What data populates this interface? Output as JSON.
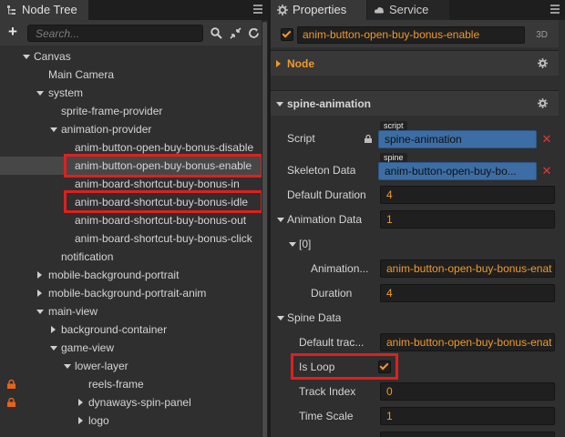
{
  "node_tree": {
    "tab_label": "Node Tree",
    "search_placeholder": "Search...",
    "rows": [
      {
        "label": "Canvas",
        "indent": 0,
        "arrow": "down"
      },
      {
        "label": "Main Camera",
        "indent": 1,
        "arrow": "none"
      },
      {
        "label": "system",
        "indent": 1,
        "arrow": "down"
      },
      {
        "label": "sprite-frame-provider",
        "indent": 2,
        "arrow": "none"
      },
      {
        "label": "animation-provider",
        "indent": 2,
        "arrow": "down"
      },
      {
        "label": "anim-button-open-buy-bonus-disable",
        "indent": 3,
        "arrow": "none"
      },
      {
        "label": "anim-button-open-buy-bonus-enable",
        "indent": 3,
        "arrow": "none",
        "selected": true
      },
      {
        "label": "anim-board-shortcut-buy-bonus-in",
        "indent": 3,
        "arrow": "none"
      },
      {
        "label": "anim-board-shortcut-buy-bonus-idle",
        "indent": 3,
        "arrow": "none"
      },
      {
        "label": "anim-board-shortcut-buy-bonus-out",
        "indent": 3,
        "arrow": "none"
      },
      {
        "label": "anim-board-shortcut-buy-bonus-click",
        "indent": 3,
        "arrow": "none"
      },
      {
        "label": "notification",
        "indent": 2,
        "arrow": "none"
      },
      {
        "label": "mobile-background-portrait",
        "indent": 1,
        "arrow": "right"
      },
      {
        "label": "mobile-background-portrait-anim",
        "indent": 1,
        "arrow": "right"
      },
      {
        "label": "main-view",
        "indent": 1,
        "arrow": "down"
      },
      {
        "label": "background-container",
        "indent": 2,
        "arrow": "right"
      },
      {
        "label": "game-view",
        "indent": 2,
        "arrow": "down"
      },
      {
        "label": "lower-layer",
        "indent": 3,
        "arrow": "down"
      },
      {
        "label": "reels-frame",
        "indent": 4,
        "arrow": "none",
        "locked": true
      },
      {
        "label": "dynaways-spin-panel",
        "indent": 4,
        "arrow": "right",
        "locked": true
      },
      {
        "label": "logo",
        "indent": 4,
        "arrow": "right"
      }
    ]
  },
  "properties": {
    "tab_label": "Properties",
    "service_tab_label": "Service",
    "node_name": "anim-button-open-buy-bonus-enable",
    "badge_3d": "3D",
    "node_section": "Node",
    "component_section": "spine-animation",
    "script": {
      "label": "Script",
      "tag": "script",
      "value": "spine-animation"
    },
    "skeleton_data": {
      "label": "Skeleton Data",
      "tag": "spine",
      "value": "anim-button-open-buy-bo..."
    },
    "default_duration": {
      "label": "Default Duration",
      "value": "4"
    },
    "animation_data": {
      "label": "Animation Data",
      "value": "1"
    },
    "index_label": "[0]",
    "animation_name": {
      "label": "Animation...",
      "value": "anim-button-open-buy-bonus-enat"
    },
    "duration": {
      "label": "Duration",
      "value": "4"
    },
    "spine_data": {
      "label": "Spine Data"
    },
    "default_track": {
      "label": "Default trac...",
      "value": "anim-button-open-buy-bonus-enat"
    },
    "is_loop": {
      "label": "Is Loop",
      "checked": true
    },
    "track_index": {
      "label": "Track Index",
      "value": "0"
    },
    "time_scale": {
      "label": "Time Scale",
      "value": "1"
    }
  },
  "colors": {
    "accent_orange": "#f09a2a",
    "selection_red": "#e01f1f",
    "asset_blue": "#3c6ea5"
  }
}
